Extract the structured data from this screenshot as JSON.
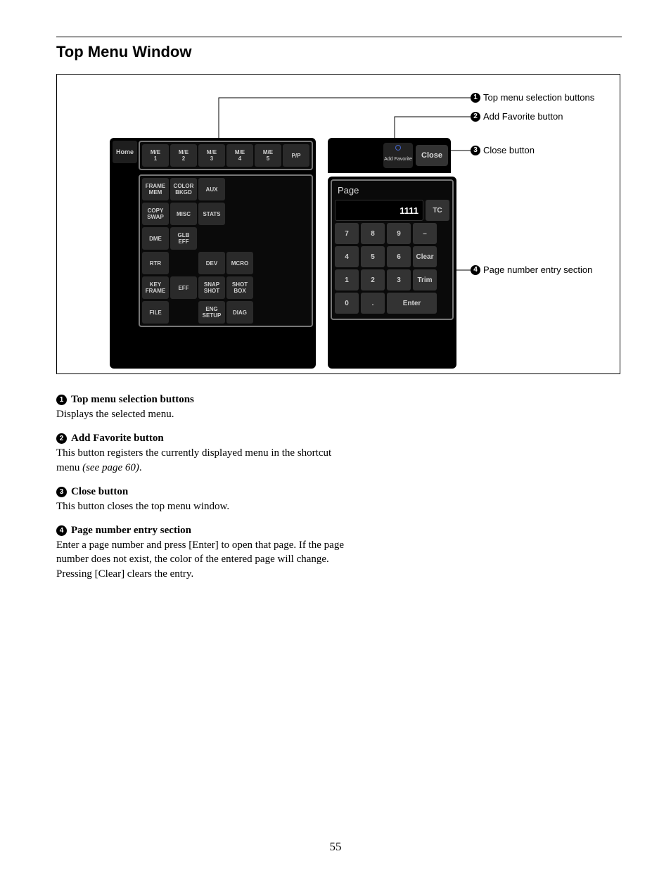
{
  "title": "Top Menu Window",
  "page_number": "55",
  "callouts": {
    "c1": "Top menu selection buttons",
    "c2": "Add Favorite button",
    "c3": "Close button",
    "c4": "Page number entry section"
  },
  "top_bar": {
    "home": "Home",
    "add_fav": "Add\nFavorite",
    "close": "Close"
  },
  "menu_row0": [
    "M/E\n1",
    "M/E\n2",
    "M/E\n3",
    "M/E\n4",
    "M/E\n5",
    "P/P"
  ],
  "menu_grid": [
    [
      "FRAME\nMEM",
      "COLOR\nBKGD",
      "AUX",
      "",
      "",
      ""
    ],
    [
      "COPY\nSWAP",
      "MISC",
      "STATS",
      "",
      "",
      ""
    ],
    [
      "DME",
      "GLB\nEFF",
      "",
      "",
      "",
      ""
    ],
    [
      "RTR",
      "",
      "DEV",
      "MCRO",
      "",
      ""
    ],
    [
      "KEY\nFRAME",
      "EFF",
      "SNAP\nSHOT",
      "SHOT\nBOX",
      "",
      ""
    ],
    [
      "FILE",
      "",
      "ENG\nSETUP",
      "DIAG",
      "",
      ""
    ]
  ],
  "keypad": {
    "title": "Page",
    "value": "1111",
    "tc": "TC",
    "rows": [
      [
        "7",
        "8",
        "9",
        "–"
      ],
      [
        "4",
        "5",
        "6",
        "Clear"
      ],
      [
        "1",
        "2",
        "3",
        "Trim"
      ]
    ],
    "last_row": {
      "zero": "0",
      "dot": ".",
      "enter": "Enter"
    }
  },
  "descriptions": [
    {
      "n": "1",
      "head": "Top menu selection buttons",
      "body": "Displays the selected menu."
    },
    {
      "n": "2",
      "head": "Add Favorite button",
      "body": "This button registers the currently displayed menu in the shortcut menu ",
      "ref": "(see page 60)",
      "tail": "."
    },
    {
      "n": "3",
      "head": "Close button",
      "body": "This button closes the top menu window."
    },
    {
      "n": "4",
      "head": "Page number entry section",
      "body": "Enter a page number and press [Enter] to open that page. If the page number does not exist, the color of the entered page will change. Pressing [Clear] clears the entry."
    }
  ]
}
